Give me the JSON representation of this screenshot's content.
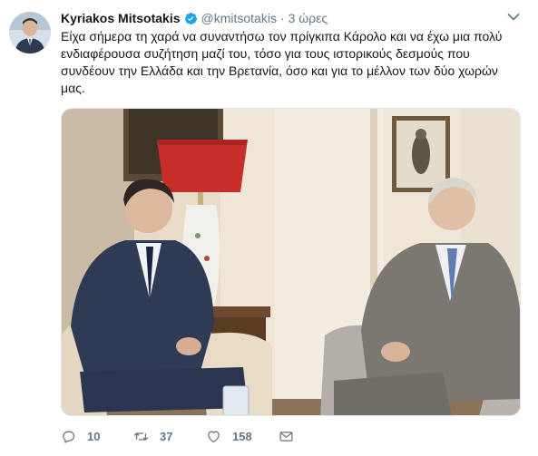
{
  "tweet": {
    "author_name": "Kyriakos Mitsotakis",
    "handle": "@kmitsotakis",
    "separator": "·",
    "time": "3 ώρες",
    "text": "Είχα σήμερα τη χαρά να συναντήσω τον πρίγκιπα Κάρολο και να έχω μια πολύ\nενδιαφέρουσα συζήτηση μαζί του, τόσο για τους ιστορικούς δεσμούς που\nσυνδέουν την Ελλάδα και την Βρετανία, όσο και για το μέλλον των δύο χωρών\nμας.",
    "replies": "10",
    "retweets": "37",
    "likes": "158"
  },
  "icons": {
    "verified": "verified-badge-icon",
    "caret": "chevron-down-icon",
    "reply": "reply-icon",
    "retweet": "retweet-icon",
    "like": "heart-icon",
    "dm": "envelope-icon"
  },
  "colors": {
    "verified": "#1da1f2",
    "secondary_text": "#657786",
    "border": "#e1e8ed"
  }
}
